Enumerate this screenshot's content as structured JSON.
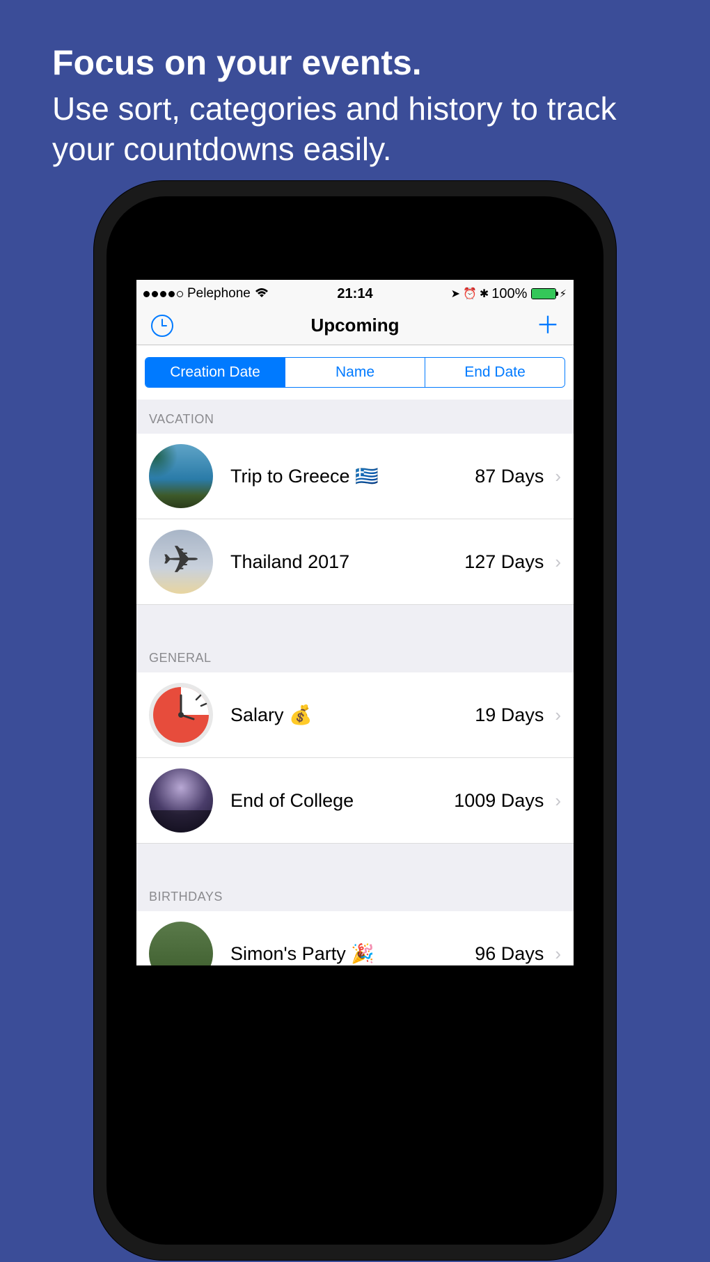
{
  "promo": {
    "title": "Focus on your events.",
    "subtitle": "Use sort, categories and history to track your countdowns easily."
  },
  "status": {
    "carrier": "Pelephone",
    "time": "21:14",
    "battery_pct": "100%"
  },
  "nav": {
    "title": "Upcoming"
  },
  "segments": {
    "creation": "Creation Date",
    "name": "Name",
    "end": "End Date"
  },
  "sections": {
    "vacation": "VACATION",
    "general": "GENERAL",
    "birthdays": "BIRTHDAYS"
  },
  "events": {
    "vacation": [
      {
        "name": "Trip to Greece 🇬🇷",
        "days": "87 Days"
      },
      {
        "name": "Thailand 2017",
        "days": "127 Days"
      }
    ],
    "general": [
      {
        "name": "Salary 💰",
        "days": "19 Days"
      },
      {
        "name": "End of College",
        "days": "1009 Days"
      }
    ],
    "birthdays": [
      {
        "name": "Simon's Party 🎉",
        "days": "96 Days"
      }
    ]
  }
}
